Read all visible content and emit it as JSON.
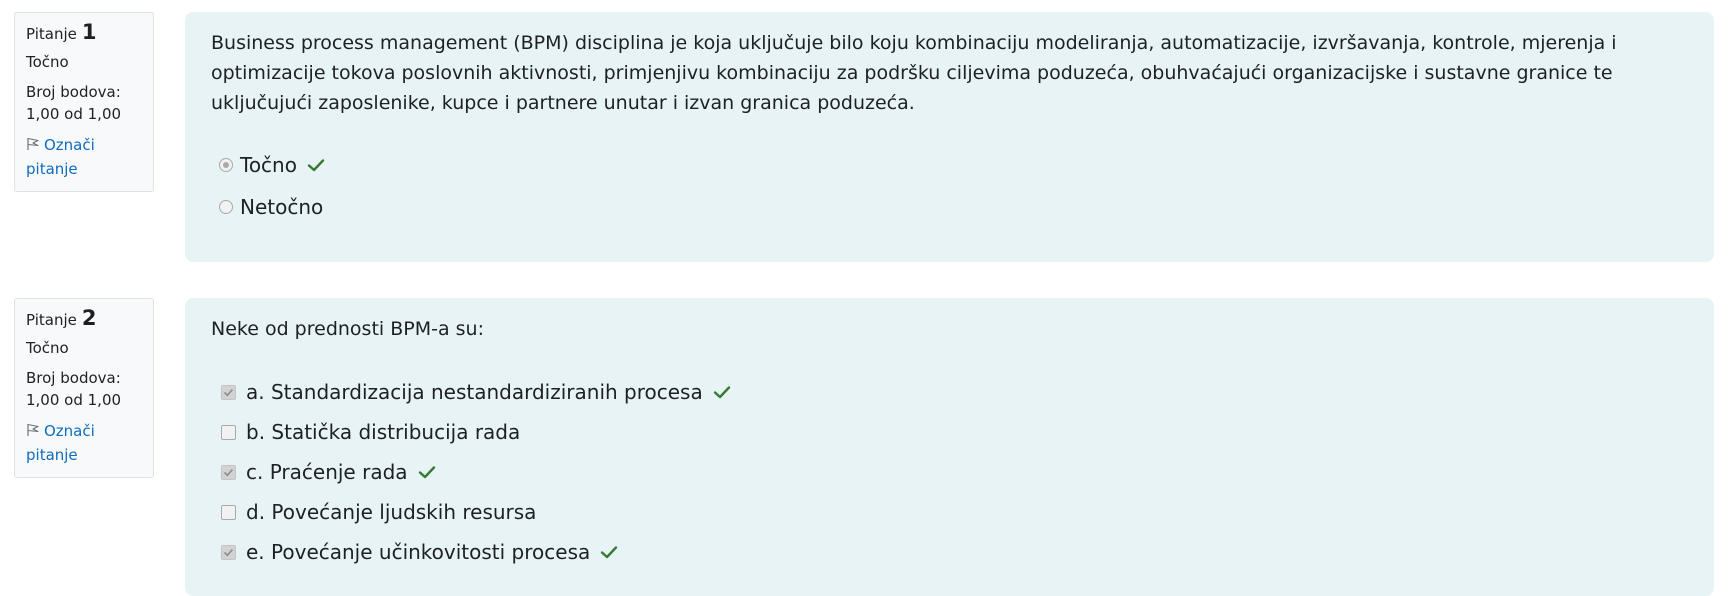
{
  "questions": [
    {
      "label": "Pitanje",
      "number": "1",
      "state": "Točno",
      "grade_label": "Broj bodova:",
      "grade_value": "1,00 od 1,00",
      "flag_label": "Označi pitanje",
      "text": "Business process management (BPM) disciplina je koja uključuje bilo koju kombinaciju modeliranja, automatizacije, izvršavanja, kontrole, mjerenja i optimizacije tokova poslovnih aktivnosti, primjenjivu kombinaciju za podršku ciljevima poduzeća, obuhvaćajući organizacijske i sustavne granice te uključujući zaposlenike, kupce i partnere unutar i izvan granica poduzeća.",
      "answers": [
        {
          "label": "Točno",
          "selected": true,
          "correct": true
        },
        {
          "label": "Netočno",
          "selected": false,
          "correct": false
        }
      ]
    },
    {
      "label": "Pitanje",
      "number": "2",
      "state": "Točno",
      "grade_label": "Broj bodova:",
      "grade_value": "1,00 od 1,00",
      "flag_label": "Označi pitanje",
      "text": "Neke od prednosti BPM-a su:",
      "answers": [
        {
          "label": "a. Standardizacija nestandardiziranih procesa",
          "selected": true,
          "correct": true
        },
        {
          "label": "b. Statička distribucija rada",
          "selected": false,
          "correct": false
        },
        {
          "label": "c. Praćenje rada",
          "selected": true,
          "correct": true
        },
        {
          "label": "d. Povećanje ljudskih resursa",
          "selected": false,
          "correct": false
        },
        {
          "label": "e. Povećanje učinkovitosti procesa",
          "selected": true,
          "correct": true
        }
      ]
    }
  ],
  "colors": {
    "correct_tick": "#357a32",
    "link": "#0f6cbf",
    "content_bg": "#e7f3f5",
    "info_bg": "#f8f9fa"
  },
  "icons": {
    "flag": "flag-icon",
    "correct": "check-icon"
  }
}
